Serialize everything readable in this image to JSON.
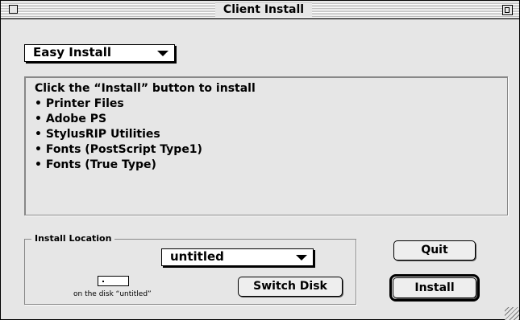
{
  "window": {
    "title": "Client Install"
  },
  "install_mode": {
    "selected": "Easy Install"
  },
  "info": {
    "lines": [
      "Click the “Install” button to install",
      "• Printer Files",
      "• Adobe PS",
      "• StylusRIP Utilities",
      "• Fonts (PostScript Type1)",
      "• Fonts (True Type)"
    ]
  },
  "location": {
    "group_label": "Install Location",
    "disk_selected": "untitled",
    "disk_caption": "on the disk “untitled”",
    "switch_disk_label": "Switch Disk"
  },
  "buttons": {
    "quit": "Quit",
    "install": "Install"
  },
  "colors": {
    "window_bg": "#e6e6e6",
    "border": "#000000"
  }
}
